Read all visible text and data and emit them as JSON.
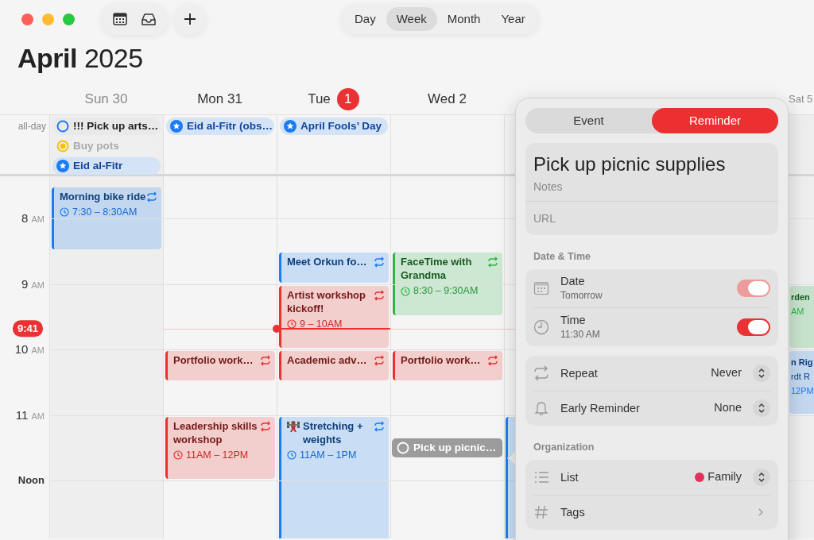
{
  "toolbar": {
    "views": [
      {
        "label": "Day",
        "selected": false
      },
      {
        "label": "Week",
        "selected": true
      },
      {
        "label": "Month",
        "selected": false
      },
      {
        "label": "Year",
        "selected": false
      }
    ]
  },
  "heading": {
    "month": "April",
    "year": "2025"
  },
  "all_day_label": "all-day",
  "days": [
    {
      "label": "Sun 30",
      "dimmed": true,
      "today": false,
      "all_day": [
        {
          "kind": "reminder",
          "title": "!!! Pick up arts…",
          "color": "#1a7cf5",
          "completed": false
        },
        {
          "kind": "reminder",
          "title": "Buy pots",
          "color": "#f2c200",
          "completed": true
        },
        {
          "kind": "holiday",
          "title": "Eid al-Fitr"
        }
      ],
      "events": [
        {
          "kind": "event",
          "title": "Morning bike ride",
          "time": "7:30 – 8:30AM",
          "color": "#1a7cf5",
          "repeats": true,
          "has_icon": false
        }
      ]
    },
    {
      "label": "Mon 31",
      "dimmed": false,
      "today": false,
      "all_day": [
        {
          "kind": "holiday",
          "title": "Eid al-Fitr (obs…"
        }
      ],
      "events": [
        {
          "kind": "event",
          "title": "Portfolio work…",
          "color": "#e8322e",
          "repeats": true,
          "has_icon": false
        },
        {
          "kind": "event",
          "title": "Leadership skills workshop",
          "time": "11AM – 12PM",
          "color": "#e8322e",
          "repeats": true,
          "has_icon": false
        }
      ]
    },
    {
      "label": "Tue",
      "badge": "1",
      "dimmed": false,
      "today": true,
      "all_day": [
        {
          "kind": "holiday",
          "title": "April Fools’ Day"
        }
      ],
      "events": [
        {
          "kind": "event",
          "title": "Meet Orkun fo…",
          "color": "#1a7cf5",
          "repeats": true,
          "has_icon": false
        },
        {
          "kind": "event",
          "title": "Artist workshop kickoff!",
          "time": "9 – 10AM",
          "color": "#e8322e",
          "repeats": true,
          "has_icon": false
        },
        {
          "kind": "event",
          "title": "Academic adv…",
          "color": "#e8322e",
          "repeats": true,
          "has_icon": false
        },
        {
          "kind": "event",
          "title": "Stretching + weights",
          "time": "11AM – 1PM",
          "color": "#1a7cf5",
          "repeats": true,
          "has_icon": true
        }
      ]
    },
    {
      "label": "Wed 2",
      "dimmed": false,
      "today": false,
      "events": [
        {
          "kind": "event",
          "title": "FaceTime with Grandma",
          "time": "8:30 – 9:30AM",
          "color": "#2fb344",
          "repeats": true,
          "has_icon": false
        },
        {
          "kind": "event",
          "title": "Portfolio work…",
          "color": "#e8322e",
          "repeats": true,
          "has_icon": false
        },
        {
          "kind": "reminder",
          "title": "Pick up picnic…",
          "selected": true
        }
      ]
    },
    {
      "label": "Sat 5",
      "dimmed": true,
      "today": false
    }
  ],
  "hours": [
    {
      "hour": "8",
      "suffix": "AM"
    },
    {
      "hour": "9",
      "suffix": "AM"
    },
    {
      "hour": "10",
      "suffix": "AM"
    },
    {
      "hour": "11",
      "suffix": "AM"
    },
    {
      "hour": "Noon"
    }
  ],
  "now": "9:41",
  "partial_events": [
    {
      "color": "#1a7cf5"
    },
    {
      "color": "#2fb344",
      "lines": [
        "rden",
        "AM"
      ]
    },
    {
      "color": "#1a7cf5",
      "lines": [
        "n Rig",
        "rdt R",
        "12PM"
      ]
    }
  ],
  "popover": {
    "tabs": [
      {
        "label": "Event",
        "selected": false
      },
      {
        "label": "Reminder",
        "selected": true
      }
    ],
    "title": "Pick up picnic supplies",
    "notes_placeholder": "Notes",
    "url_placeholder": "URL",
    "sections": [
      {
        "heading": "Date & Time",
        "groups": [
          {
            "rows": [
              {
                "kind": "toggle",
                "label": "Date",
                "detail": "Tomorrow",
                "on": true,
                "dimmed": true
              },
              {
                "kind": "toggle",
                "label": "Time",
                "detail": "11:30 AM",
                "on": true,
                "dimmed": false
              }
            ]
          },
          {
            "rows": [
              {
                "kind": "select",
                "label": "Repeat",
                "value": "Never"
              },
              {
                "kind": "select",
                "label": "Early Reminder",
                "value": "None"
              }
            ]
          }
        ]
      },
      {
        "heading": "Organization",
        "groups": [
          {
            "rows": [
              {
                "kind": "select",
                "label": "List",
                "value": "Family",
                "color": "#e0325a"
              },
              {
                "kind": "link",
                "label": "Tags"
              }
            ]
          }
        ]
      }
    ]
  }
}
